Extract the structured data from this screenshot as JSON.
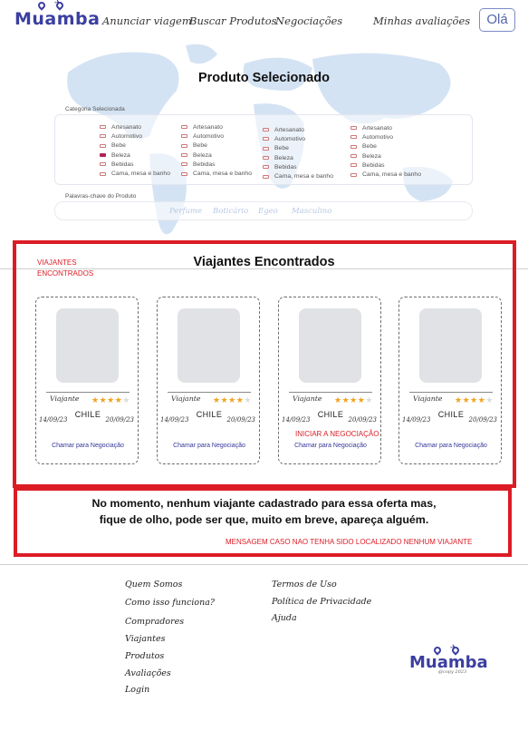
{
  "header": {
    "logo": "Muamba",
    "nav": [
      "Anunciar viagem",
      "Buscar Produtos",
      "Negociações",
      "Minhas avaliações"
    ],
    "user_button": "Olá"
  },
  "product": {
    "title": "Produto Selecionado",
    "category_label": "Categoria Selecionada",
    "categories": [
      [
        {
          "label": "Artesanato",
          "checked": false
        },
        {
          "label": "Automotivo",
          "checked": false
        },
        {
          "label": "Bebe",
          "checked": false
        },
        {
          "label": "Beleza",
          "checked": true
        },
        {
          "label": "Bebidas",
          "checked": false
        },
        {
          "label": "Cama, mesa e banho",
          "checked": false
        }
      ],
      [
        {
          "label": "Artesanato",
          "checked": false
        },
        {
          "label": "Automotivo",
          "checked": false
        },
        {
          "label": "Bebe",
          "checked": false
        },
        {
          "label": "Beleza",
          "checked": false
        },
        {
          "label": "Bebidas",
          "checked": false
        },
        {
          "label": "Cama, mesa e banho",
          "checked": false
        }
      ],
      [
        {
          "label": "Artesanato",
          "checked": false
        },
        {
          "label": "Automotivo",
          "checked": false
        },
        {
          "label": "Bebe",
          "checked": false
        },
        {
          "label": "Beleza",
          "checked": false
        },
        {
          "label": "Bebidas",
          "checked": false
        },
        {
          "label": "Cama, mesa e banho",
          "checked": false
        }
      ],
      [
        {
          "label": "Artesanato",
          "checked": false
        },
        {
          "label": "Automotivo",
          "checked": false
        },
        {
          "label": "Bebe",
          "checked": false
        },
        {
          "label": "Beleza",
          "checked": false
        },
        {
          "label": "Bebidas",
          "checked": false
        },
        {
          "label": "Cama, mesa e banho",
          "checked": false
        }
      ]
    ],
    "keywords_label": "Palavras-chave do Produto",
    "keywords": [
      "Perfume",
      "Boticário",
      "Egeo",
      "Masculino"
    ]
  },
  "travelers": {
    "annotation": [
      "VIAJANTES",
      "ENCONTRADOS"
    ],
    "title": "Viajantes Encontrados",
    "negotiation_annotation": "INICIAR A NEGOCIAÇÃO",
    "cards": [
      {
        "name": "Viajante",
        "rating": 4,
        "max_rating": 5,
        "country": "CHILE",
        "date_from": "14/09/23",
        "date_to": "20/09/23",
        "cta": "Chamar para Negociação"
      },
      {
        "name": "Viajante",
        "rating": 4,
        "max_rating": 5,
        "country": "CHILE",
        "date_from": "14/09/23",
        "date_to": "20/09/23",
        "cta": "Chamar para Negociação"
      },
      {
        "name": "Viajante",
        "rating": 4,
        "max_rating": 5,
        "country": "CHILE",
        "date_from": "14/09/23",
        "date_to": "20/09/23",
        "cta": "Chamar para Negociação"
      },
      {
        "name": "Viajante",
        "rating": 4,
        "max_rating": 5,
        "country": "CHILE",
        "date_from": "14/09/23",
        "date_to": "20/09/23",
        "cta": "Chamar para Negociação"
      }
    ]
  },
  "empty_state": {
    "line1": "No momento, nenhum viajante cadastrado para essa oferta mas,",
    "line2": "fique de olho, pode ser que, muito em breve, apareça alguém.",
    "annotation": "MENSAGEM CASO NAO TENHA SIDO LOCALIZADO NENHUM VIAJANTE"
  },
  "footer": {
    "col1": [
      "Quem Somos",
      "Como isso funciona?",
      "Compradores",
      "Viajantes",
      "Produtos",
      "Avaliações",
      "Login"
    ],
    "col2": [
      "Termos de Uso",
      "Política de Privacidade",
      "Ajuda"
    ],
    "logo": "Muamba",
    "copyright": "@copy 2023"
  },
  "colors": {
    "brand": "#3b3fa0",
    "annotation_red": "#dc1c25",
    "star": "#f0a21e",
    "map": "#cfe0f1"
  }
}
